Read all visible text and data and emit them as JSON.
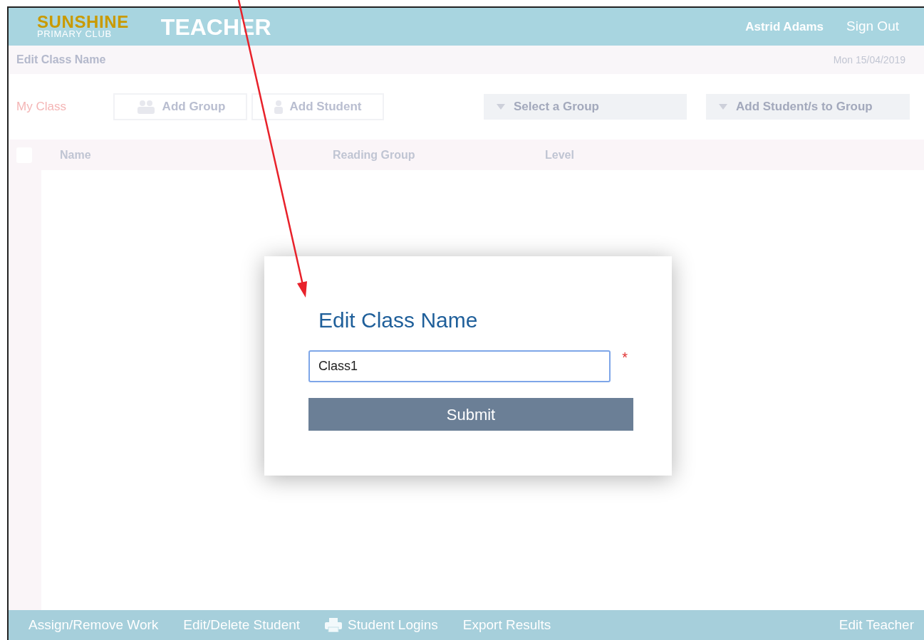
{
  "header": {
    "logo_top": "SUNSHINE",
    "logo_bottom": "PRIMARY CLUB",
    "title": "TEACHER",
    "user": "Astrid Adams",
    "sign_out": "Sign Out"
  },
  "subheader": {
    "page": "Edit Class Name",
    "date": "Mon 15/04/2019"
  },
  "toolbar": {
    "class_label": "My Class",
    "add_group": "Add Group",
    "add_student": "Add Student",
    "select_group": "Select a Group",
    "add_to_group": "Add Student/s to Group"
  },
  "table": {
    "select_all_checked": false,
    "columns": [
      "Name",
      "Reading Group",
      "Level"
    ]
  },
  "dialog": {
    "title": "Edit Class Name",
    "value": "Class1",
    "required_mark": "*",
    "submit": "Submit"
  },
  "footer": {
    "items": [
      {
        "label": "Assign/Remove Work",
        "kind": "text"
      },
      {
        "label": "Edit/Delete Student",
        "kind": "text"
      },
      {
        "label": "Student Logins",
        "kind": "printer"
      },
      {
        "label": "Export Results",
        "kind": "text"
      }
    ],
    "right": "Edit Teacher"
  }
}
